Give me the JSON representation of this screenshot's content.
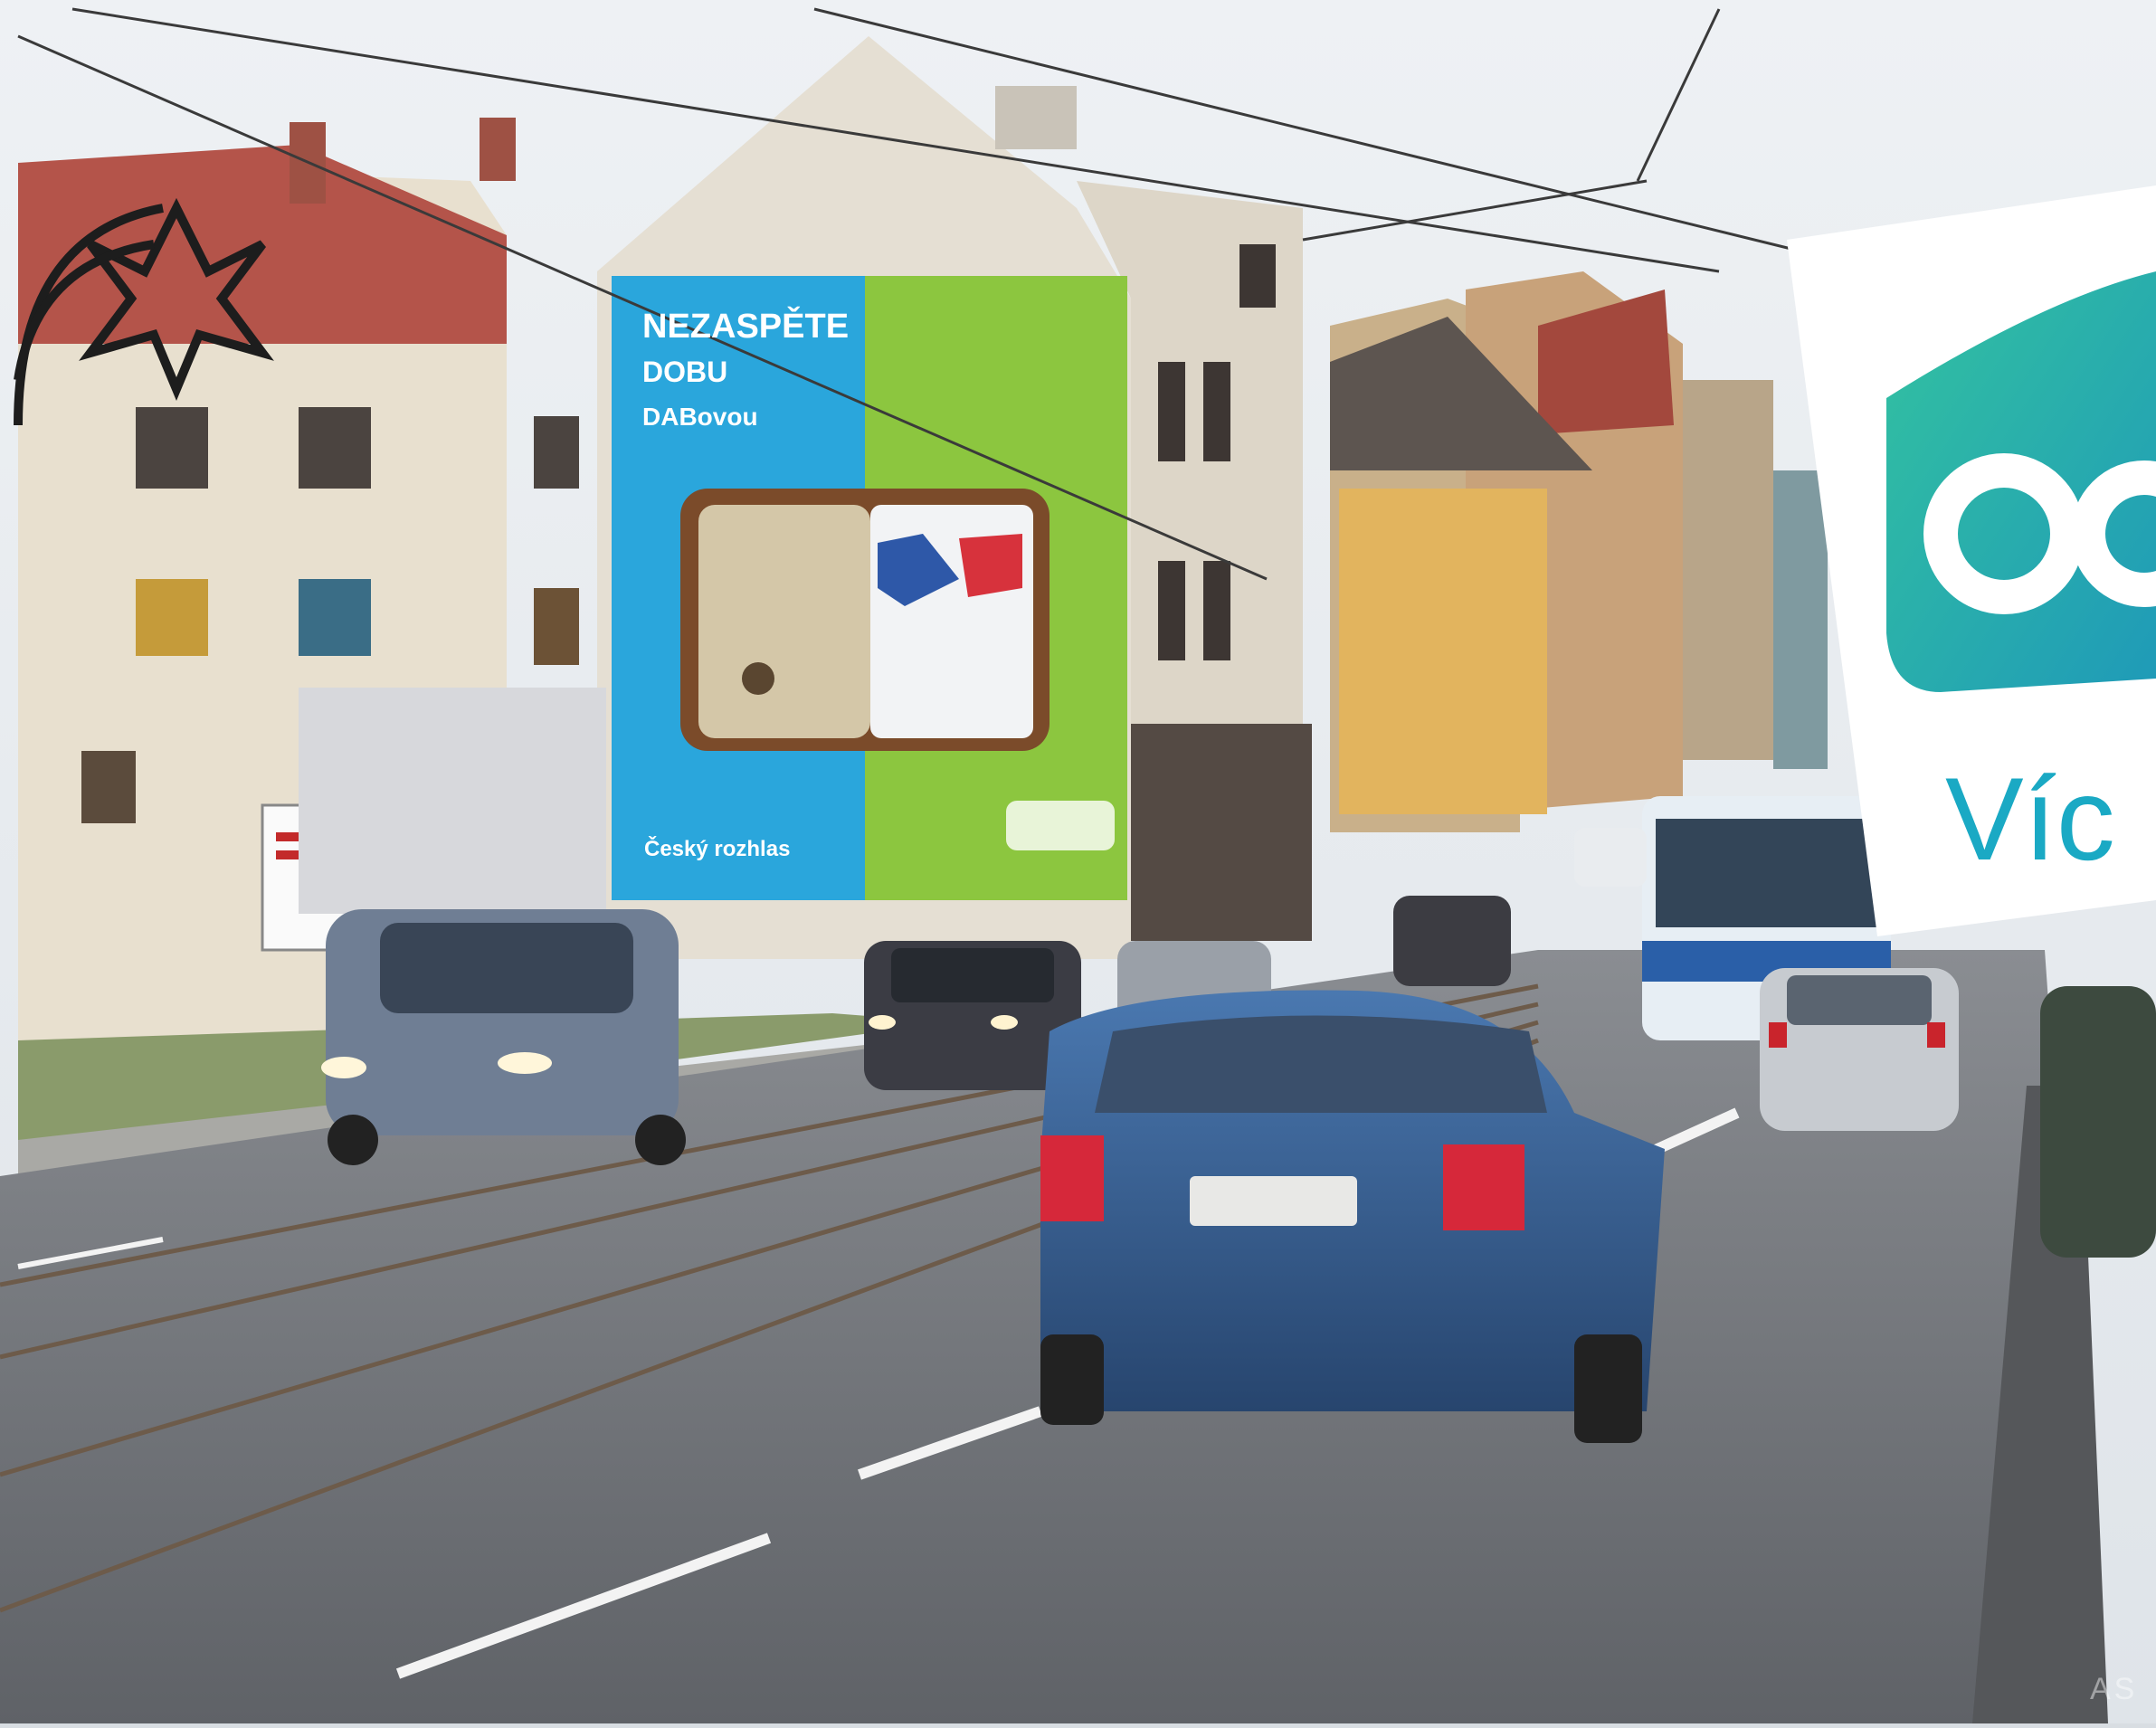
{
  "billboard": {
    "line1": "NEZASPĚTE",
    "line2": "DOBU",
    "line3": "DABovou",
    "brand": "Český rozhlas",
    "colors": {
      "left": "#2aa6dc",
      "right": "#8cc63f"
    }
  },
  "logo": {
    "text": "Víc",
    "colors": {
      "badge": "#2bb5a0",
      "text": "#1aa9c4"
    }
  },
  "watermark": "AS"
}
